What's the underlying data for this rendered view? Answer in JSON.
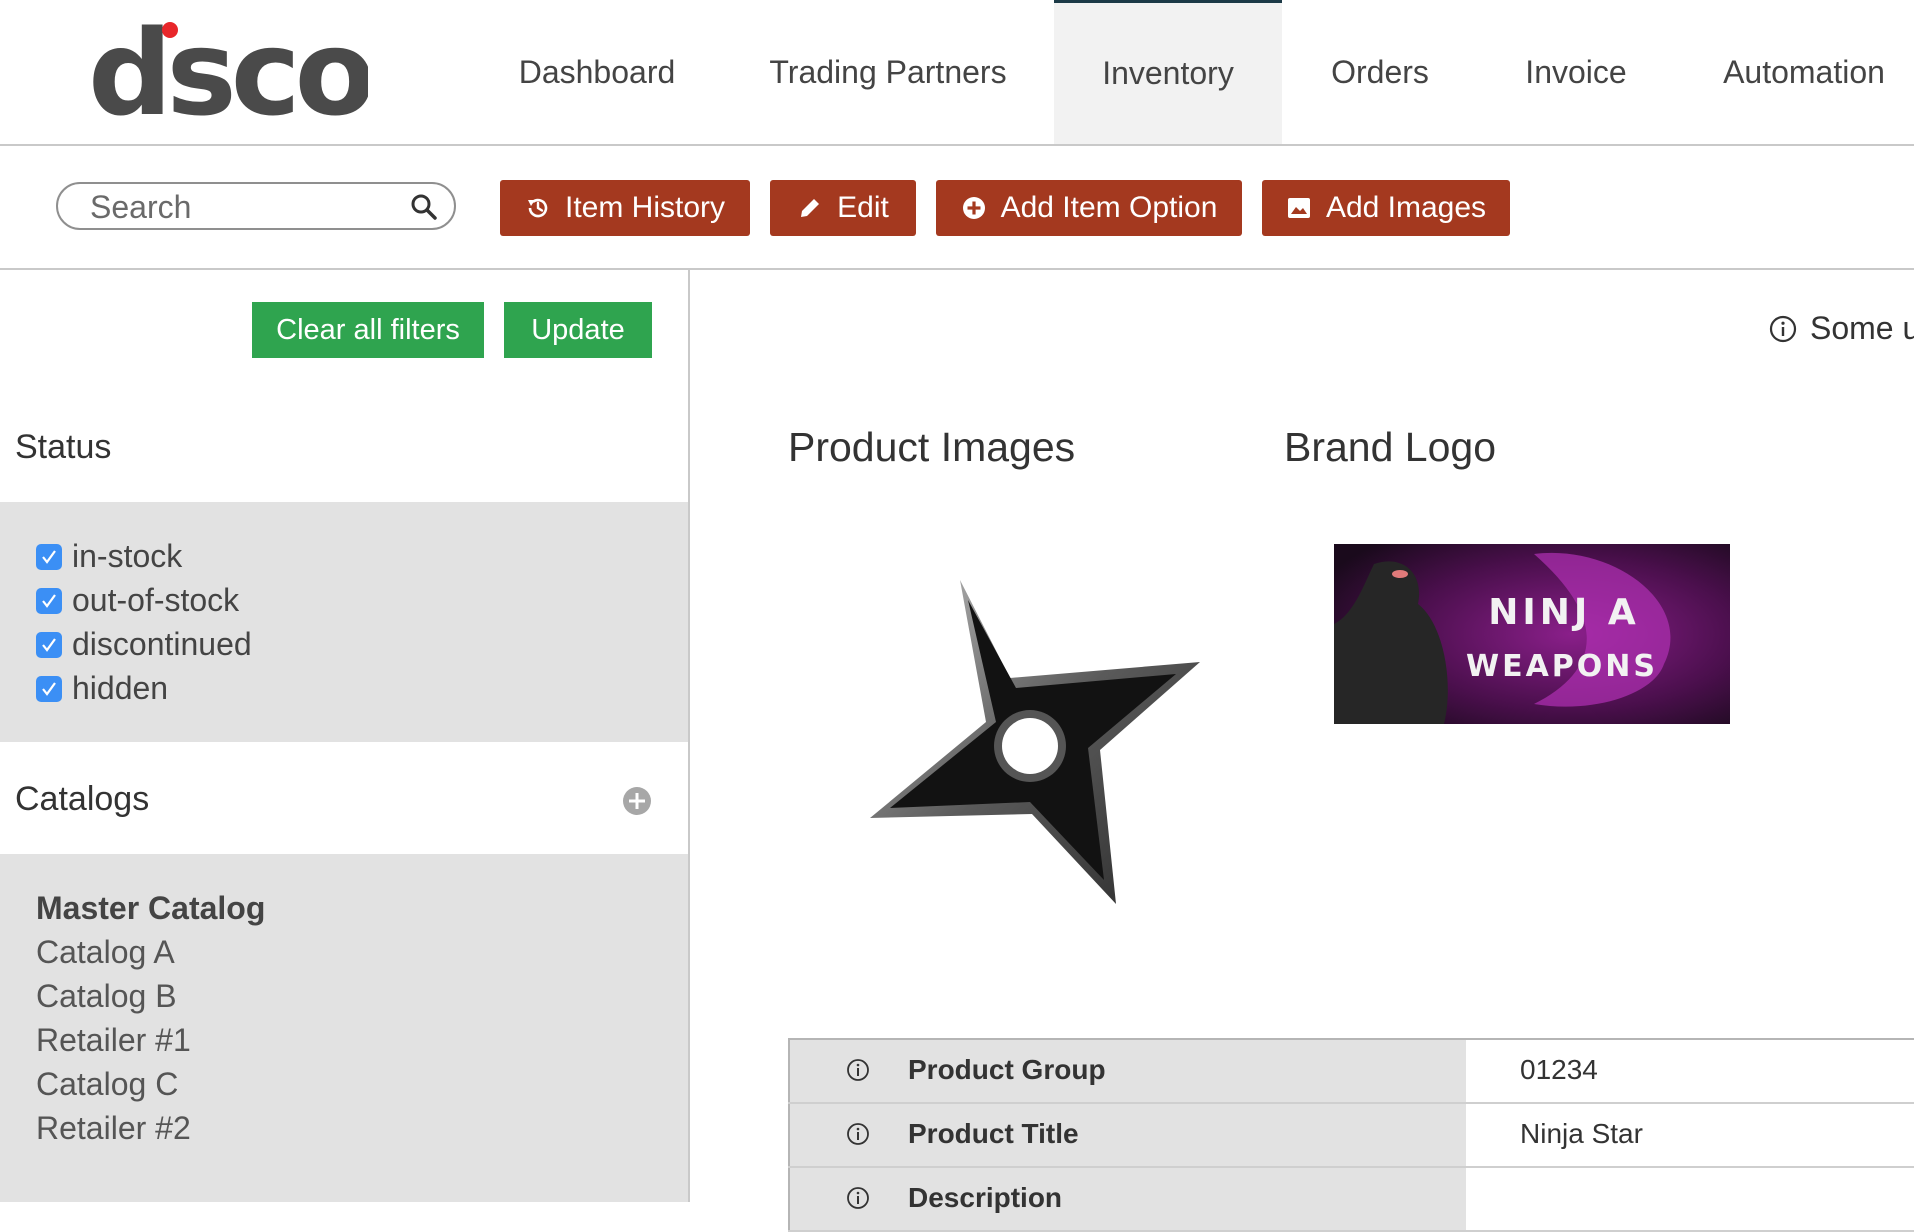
{
  "brand": {
    "logo_text": "dsco",
    "accent_color": "#e8262a"
  },
  "nav": {
    "items": [
      {
        "label": "Dashboard"
      },
      {
        "label": "Trading Partners"
      },
      {
        "label": "Inventory",
        "active": true
      },
      {
        "label": "Orders"
      },
      {
        "label": "Invoice"
      },
      {
        "label": "Automation"
      }
    ]
  },
  "toolbar": {
    "search_placeholder": "Search",
    "item_history": "Item History",
    "edit": "Edit",
    "add_item_option": "Add Item Option",
    "add_images": "Add Images",
    "button_color": "#a4391f"
  },
  "sidebar": {
    "clear_filters": "Clear all filters",
    "update": "Update",
    "status_title": "Status",
    "statuses": [
      {
        "label": "in-stock",
        "checked": true
      },
      {
        "label": "out-of-stock",
        "checked": true
      },
      {
        "label": "discontinued",
        "checked": true
      },
      {
        "label": "hidden",
        "checked": true
      }
    ],
    "catalogs_title": "Catalogs",
    "catalogs": [
      {
        "label": "Master Catalog",
        "bold": true
      },
      {
        "label": "Catalog A"
      },
      {
        "label": "Catalog B"
      },
      {
        "label": "Retailer #1"
      },
      {
        "label": "Catalog C"
      },
      {
        "label": "Retailer #2"
      }
    ],
    "button_color": "#2fa44f"
  },
  "main": {
    "notice_text": "Some u",
    "product_images_title": "Product Images",
    "brand_logo_title": "Brand Logo",
    "brand_logo_lines": [
      "NINJ A",
      "WEAPONS"
    ],
    "attributes": [
      {
        "label": "Product Group",
        "value": "01234"
      },
      {
        "label": "Product Title",
        "value": "Ninja Star"
      },
      {
        "label": "Description",
        "value": ""
      }
    ]
  }
}
